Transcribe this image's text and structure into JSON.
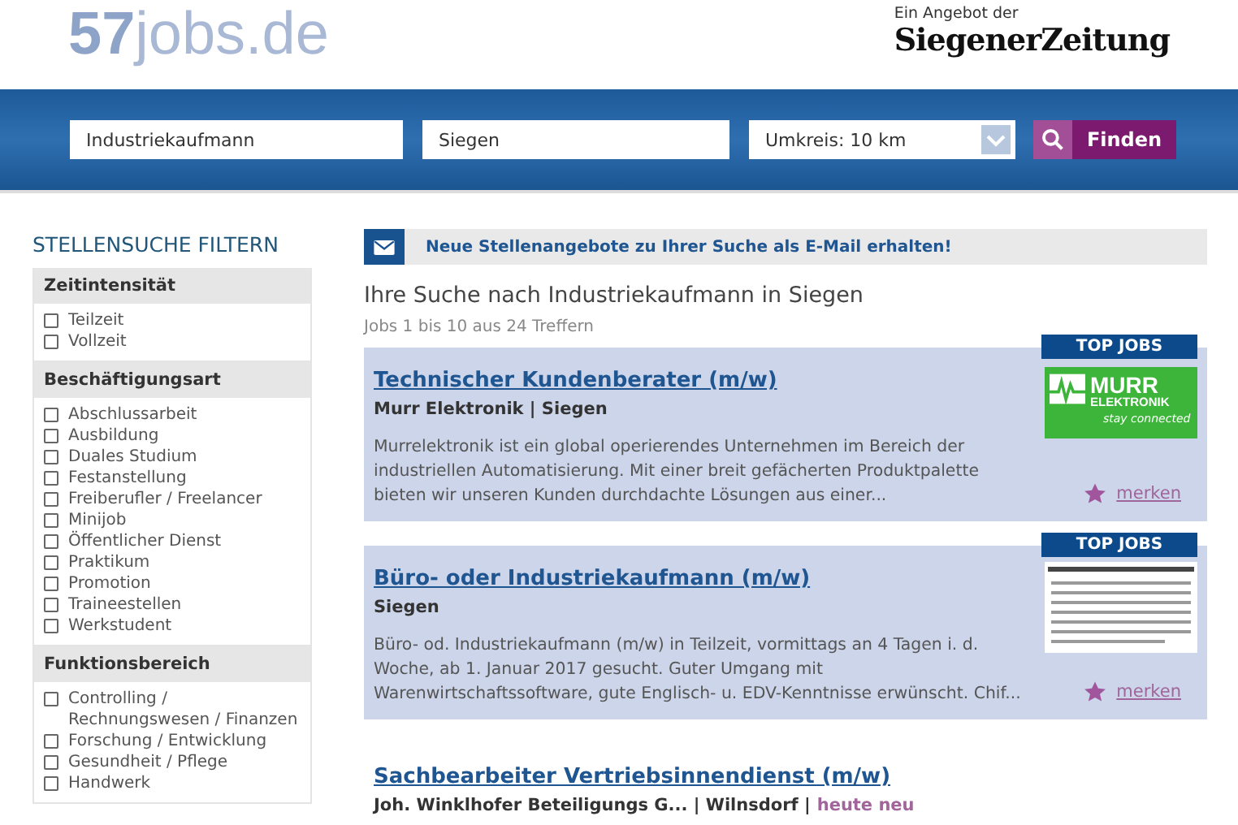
{
  "header": {
    "logo_number": "57",
    "logo_text": "jobs.de",
    "partner_caption": "Ein Angebot der",
    "partner_name": "SiegenerZeitung"
  },
  "search": {
    "keyword": "Industriekaufmann",
    "location": "Siegen",
    "radius": "Umkreis: 10 km",
    "button": "Finden"
  },
  "sidebar": {
    "title": "STELLENSUCHE FILTERN",
    "groups": [
      {
        "title": "Zeitintensität",
        "items": [
          {
            "label": "Teilzeit",
            "checked": false
          },
          {
            "label": "Vollzeit",
            "checked": false
          }
        ]
      },
      {
        "title": "Beschäftigungsart",
        "items": [
          {
            "label": "Abschlussarbeit",
            "checked": false
          },
          {
            "label": "Ausbildung",
            "checked": false
          },
          {
            "label": "Duales Studium",
            "checked": false
          },
          {
            "label": "Festanstellung",
            "checked": false
          },
          {
            "label": "Freiberufler / Freelancer",
            "checked": false
          },
          {
            "label": "Minijob",
            "checked": false
          },
          {
            "label": "Öffentlicher Dienst",
            "checked": false
          },
          {
            "label": "Praktikum",
            "checked": false
          },
          {
            "label": "Promotion",
            "checked": false
          },
          {
            "label": "Traineestellen",
            "checked": false
          },
          {
            "label": "Werkstudent",
            "checked": false
          }
        ]
      },
      {
        "title": "Funktionsbereich",
        "items": [
          {
            "label": "Controlling / Rechnungswesen / Finanzen",
            "checked": false
          },
          {
            "label": "Forschung / Entwicklung",
            "checked": false
          },
          {
            "label": "Gesundheit / Pflege",
            "checked": false
          },
          {
            "label": "Handwerk",
            "checked": false
          }
        ]
      }
    ]
  },
  "alert_bar": {
    "text": "Neue Stellenangebote zu Ihrer Suche als E-Mail erhalten!"
  },
  "results": {
    "heading": "Ihre Suche nach Industriekaufmann in Siegen",
    "count": "Jobs 1 bis 10 aus 24 Treffern"
  },
  "jobs": [
    {
      "top_job": true,
      "badge": "TOP JOBS",
      "logo_lines": [
        "MURR",
        "ELEKTRONIK",
        "stay connected"
      ],
      "title": "Technischer Kundenberater (m/w)",
      "meta": "Murr Elektronik | Siegen",
      "description": "Murrelektronik ist ein global operierendes Unternehmen im Bereich der industriellen Automatisierung. Mit einer breit gefächerten Produktpalette bieten wir unseren Kunden durchdachte Lösungen aus einer...",
      "save": "merken"
    },
    {
      "top_job": true,
      "badge": "TOP JOBS",
      "title": "Büro- oder Industriekaufmann (m/w)",
      "meta": "Siegen",
      "description": "Büro- od. Industriekaufmann (m/w) in Teilzeit, vormittags an 4 Tagen i. d. Woche, ab 1. Januar 2017 gesucht. Guter Umgang mit Warenwirtschaftssoftware, gute Englisch- u. EDV-Kenntnisse erwünscht. Chif...",
      "save": "merken"
    },
    {
      "top_job": false,
      "title": "Sachbearbeiter Vertriebsinnendienst (m/w)",
      "meta": "Joh. Winklhofer Beteiligungs G... | Wilnsdorf |",
      "new_label": "heute neu"
    }
  ]
}
